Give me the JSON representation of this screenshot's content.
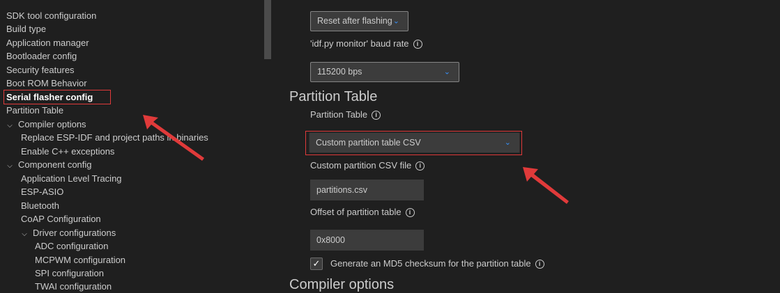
{
  "sidebar": {
    "items": [
      {
        "label": "SDK tool configuration"
      },
      {
        "label": "Build type"
      },
      {
        "label": "Application manager"
      },
      {
        "label": "Bootloader config"
      },
      {
        "label": "Security features"
      },
      {
        "label": "Boot ROM Behavior"
      },
      {
        "label": "Serial flasher config"
      },
      {
        "label": "Partition Table"
      },
      {
        "label": "Compiler options"
      },
      {
        "label": "Replace ESP-IDF and project paths in binaries"
      },
      {
        "label": "Enable C++ exceptions"
      },
      {
        "label": "Component config"
      },
      {
        "label": "Application Level Tracing"
      },
      {
        "label": "ESP-ASIO"
      },
      {
        "label": "Bluetooth"
      },
      {
        "label": "CoAP Configuration"
      },
      {
        "label": "Driver configurations"
      },
      {
        "label": "ADC configuration"
      },
      {
        "label": "MCPWM configuration"
      },
      {
        "label": "SPI configuration"
      },
      {
        "label": "TWAI configuration"
      }
    ]
  },
  "main": {
    "after_flash_select": "Reset after flashing",
    "baud_label": "'idf.py monitor' baud rate",
    "baud_select": "115200 bps",
    "section_title": "Partition Table",
    "partition_table_label": "Partition Table",
    "partition_table_select": "Custom partition table CSV",
    "csv_file_label": "Custom partition CSV file",
    "csv_file_value": "partitions.csv",
    "offset_label": "Offset of partition table",
    "offset_value": "0x8000",
    "md5_label": "Generate an MD5 checksum for the partition table",
    "md5_checked": true,
    "next_section_title": "Compiler options"
  },
  "icons": {
    "chevron_down": "⌄",
    "chevron_open": "⌵",
    "info": "i",
    "check": "✓"
  },
  "colors": {
    "background": "#1f1f1f",
    "input_bg": "#3c3c3c",
    "accent": "#3794ff",
    "annotation_red": "#e03a3a"
  }
}
